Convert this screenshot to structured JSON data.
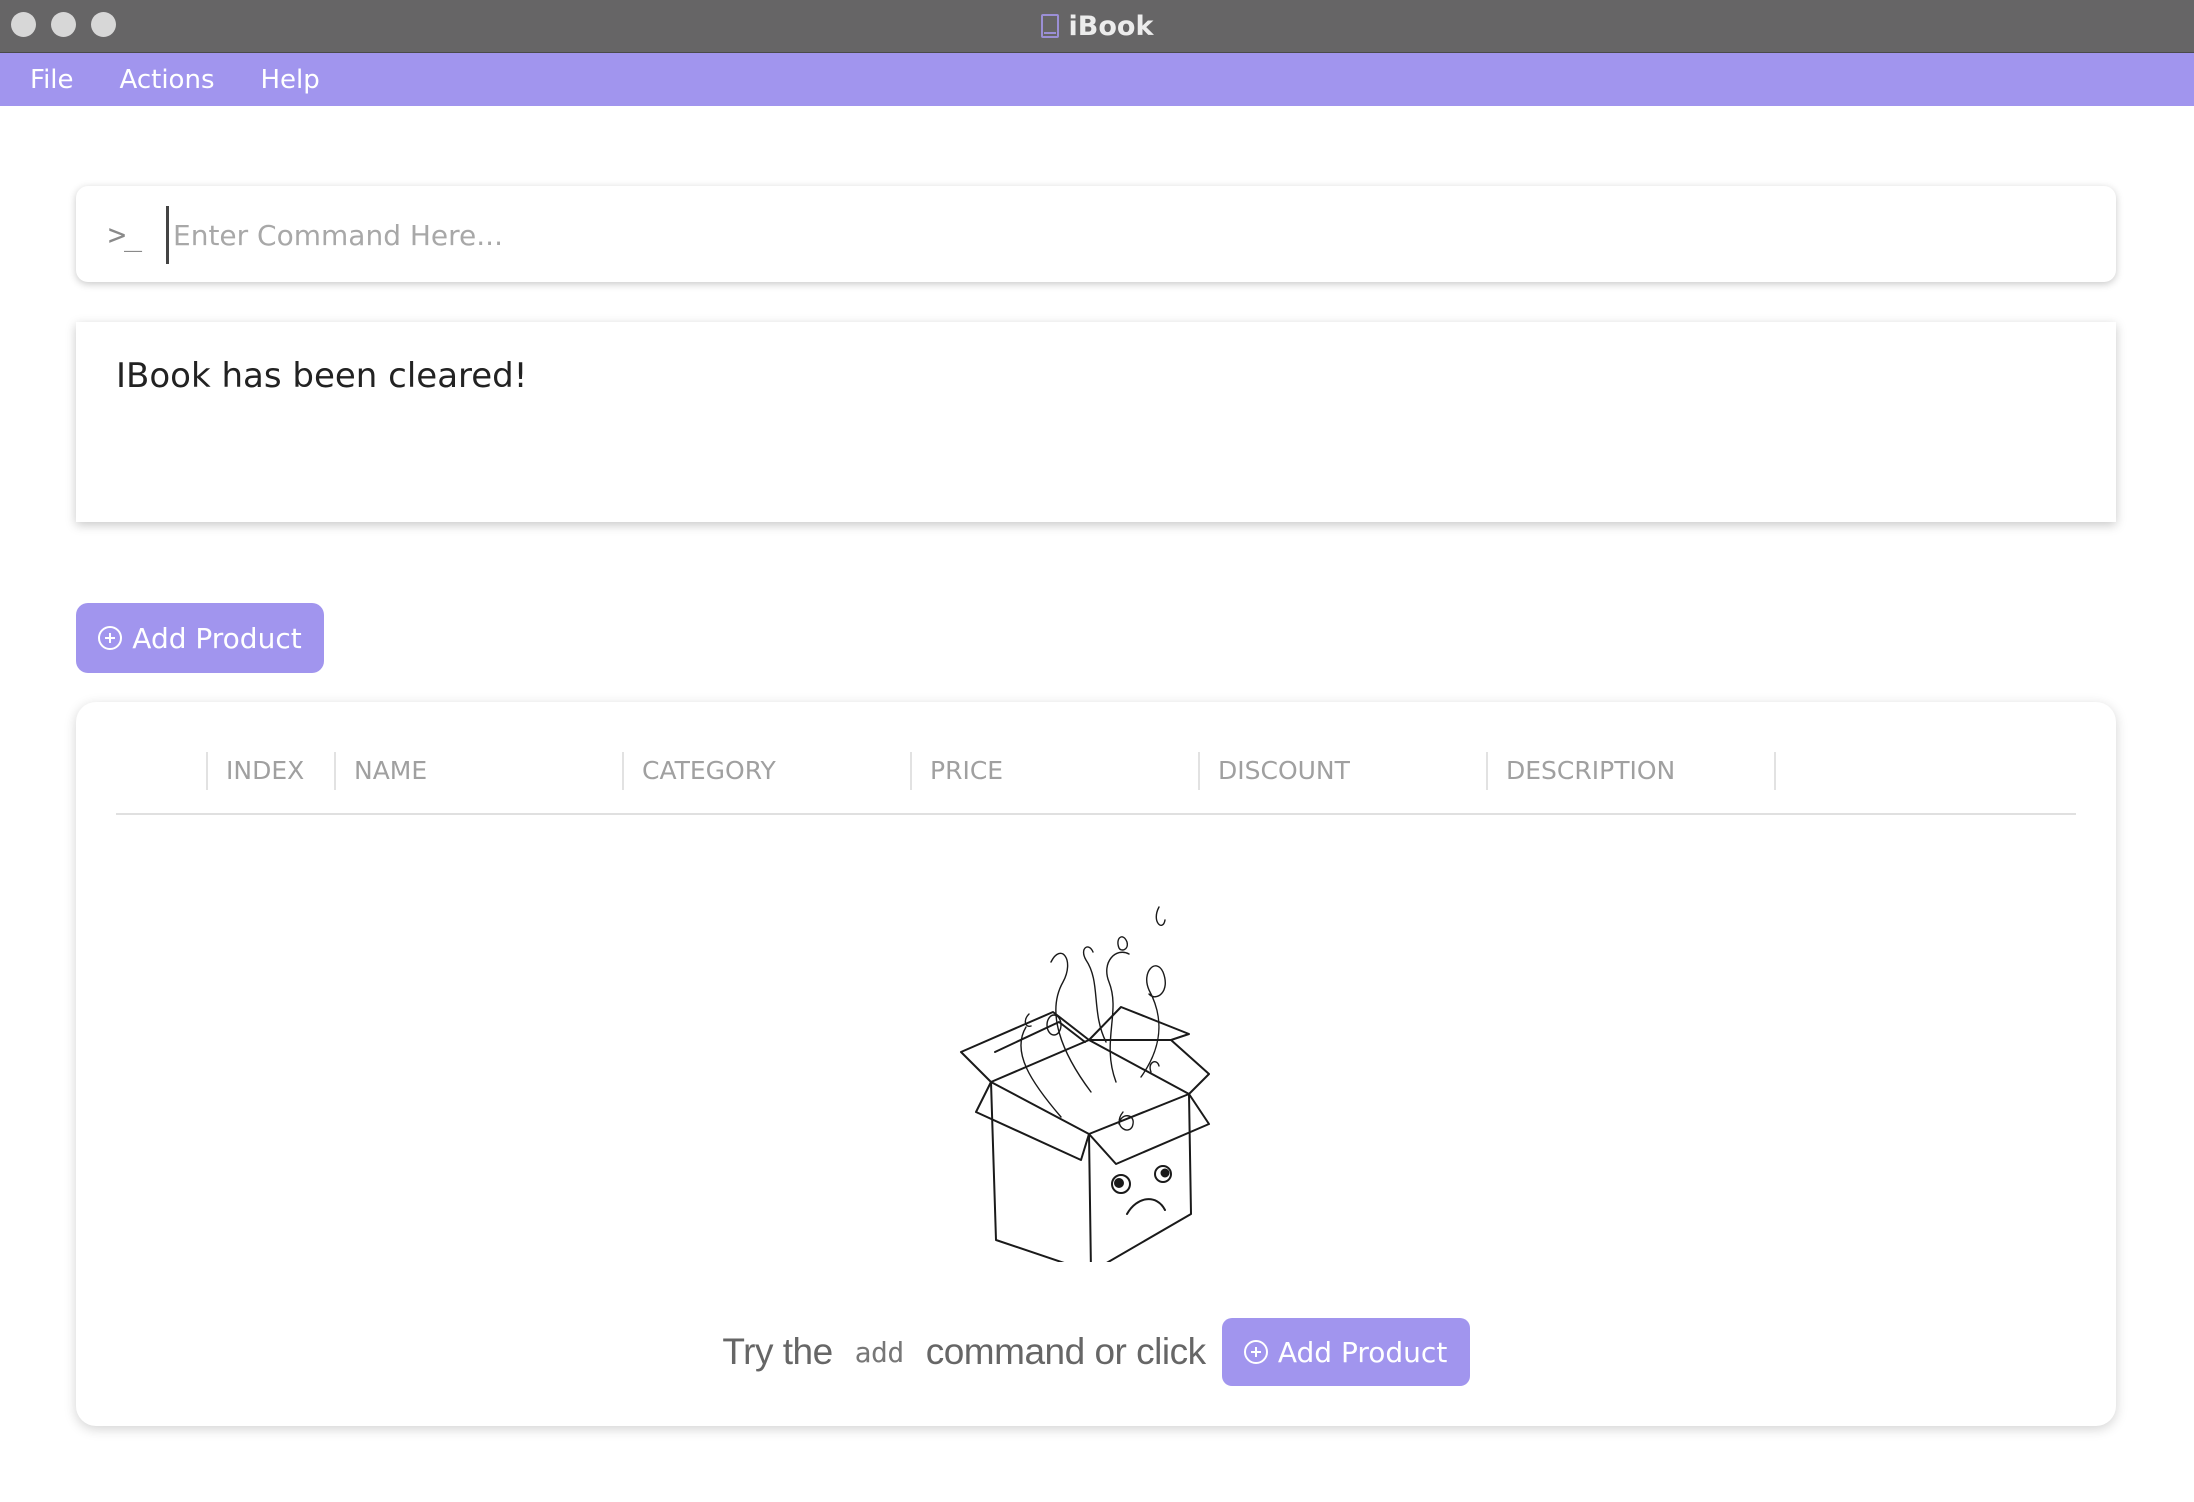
{
  "window": {
    "title": "iBook",
    "icon": "book-icon"
  },
  "menu": {
    "items": [
      "File",
      "Actions",
      "Help"
    ]
  },
  "command": {
    "placeholder": "Enter Command Here...",
    "value": "",
    "icon": "terminal-prompt-icon"
  },
  "result": {
    "message": "IBook has been cleared!"
  },
  "toolbar": {
    "add_label": "Add Product"
  },
  "table": {
    "columns": [
      "INDEX",
      "NAME",
      "CATEGORY",
      "PRICE",
      "DISCOUNT",
      "DESCRIPTION"
    ],
    "rows": []
  },
  "empty_state": {
    "text_before": "Try the",
    "code": "add",
    "text_after": "command or click",
    "button_label": "Add Product",
    "illustration": "sad-empty-box-illustration"
  },
  "colors": {
    "accent": "#a195ee",
    "titlebar": "#666566"
  }
}
